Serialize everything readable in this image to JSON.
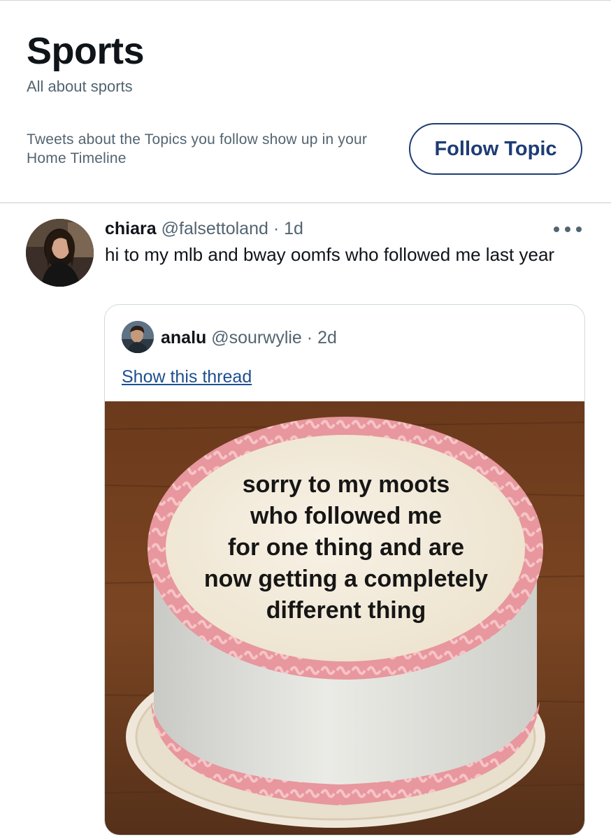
{
  "topic": {
    "title": "Sports",
    "subtitle": "All about sports",
    "note": "Tweets about the Topics you follow show up in your Home Timeline",
    "follow_label": "Follow Topic"
  },
  "tweet": {
    "author_name": "chiara",
    "author_handle": "@falsettoland",
    "time": "1d",
    "separator": "·",
    "text": "hi to my mlb and bway oomfs who followed me last year",
    "more_icon": "more-dots-icon"
  },
  "quote": {
    "author_name": "analu",
    "author_handle": "@sourwylie",
    "time": "2d",
    "separator": "·",
    "thread_link": "Show this thread",
    "image_lines": [
      "sorry to my moots",
      "who followed me",
      "for one thing and are",
      "now getting a completely",
      "different thing"
    ]
  },
  "colors": {
    "accent": "#1d3c74",
    "secondary_text": "#536471",
    "link": "#1d4f8f",
    "frosting_pink": "#eba3a8"
  }
}
